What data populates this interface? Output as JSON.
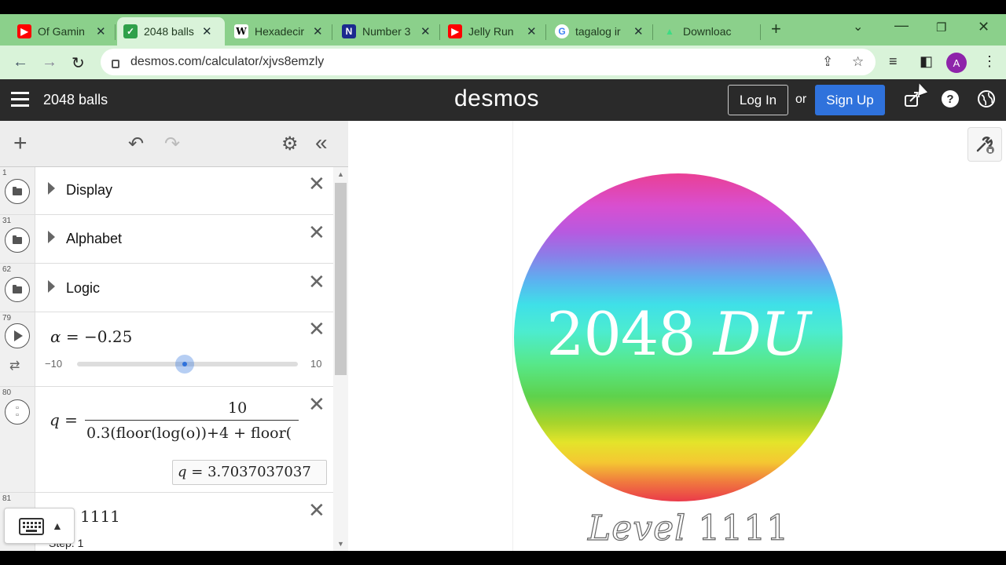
{
  "browser": {
    "tabs": [
      {
        "title": "Of Gamin",
        "icon": "youtube-icon"
      },
      {
        "title": "2048 balls",
        "icon": "desmos-icon"
      },
      {
        "title": "Hexadecir",
        "icon": "wikipedia-icon"
      },
      {
        "title": "Number 3",
        "icon": "notion-icon"
      },
      {
        "title": "Jelly Run",
        "icon": "youtube-icon"
      },
      {
        "title": "tagalog ir",
        "icon": "google-icon"
      },
      {
        "title": "Downloac",
        "icon": "android-icon"
      }
    ],
    "active_tab": 1,
    "url": "desmos.com/calculator/xjvs8emzly",
    "profile_initial": "A"
  },
  "desmos": {
    "graph_title": "2048 balls",
    "logo": "desmos",
    "login_label": "Log In",
    "or_label": "or",
    "signup_label": "Sign Up"
  },
  "expressions": {
    "folders": [
      {
        "num": "1",
        "label": "Display"
      },
      {
        "num": "31",
        "label": "Alphabet"
      },
      {
        "num": "62",
        "label": "Logic"
      }
    ],
    "slider": {
      "num": "79",
      "var": "α",
      "eq": "=",
      "value": "−0.25",
      "min": "−10",
      "max": "10",
      "fraction": 0.4875
    },
    "formula": {
      "num": "80",
      "var": "q",
      "eq": "=",
      "numerator": "10",
      "denominator_a": "0.3",
      "denominator_b": "(floor(log(o))+4 + floor(",
      "result_var": "q",
      "result_eq": "=",
      "result_value": "3.7037037037"
    },
    "row81": {
      "num": "81",
      "value": "1111",
      "step_label": "Step: 1"
    }
  },
  "graph": {
    "ball_number": "2048",
    "ball_suffix": "DU",
    "level_word": "Level",
    "level_value": "1111"
  }
}
